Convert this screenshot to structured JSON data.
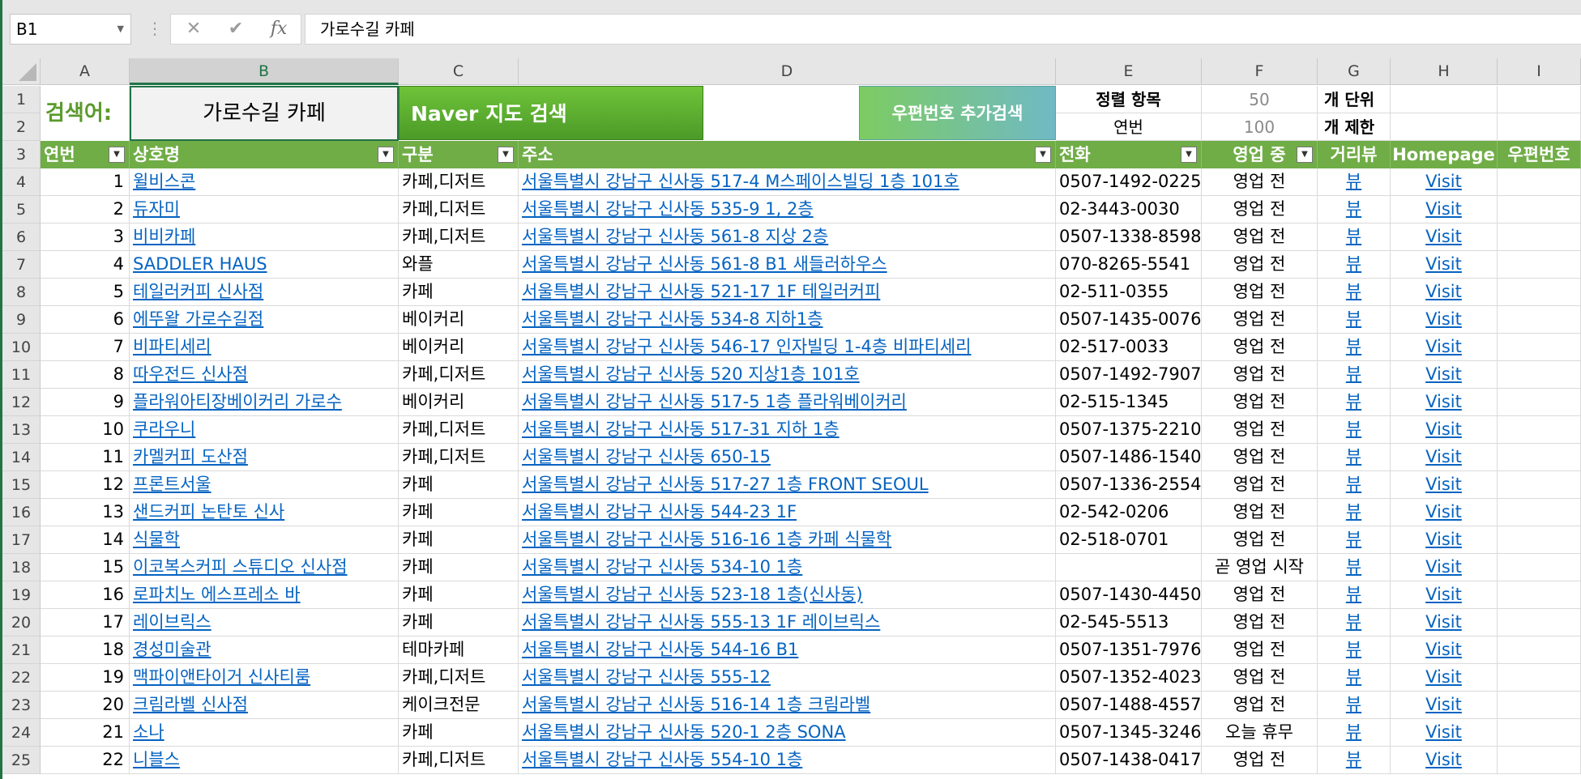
{
  "formula_bar": {
    "name_box": "B1",
    "dots": "⋮",
    "cancel": "✕",
    "enter": "✔",
    "fx": "fx",
    "value": "가로수길 카페"
  },
  "columns": [
    "A",
    "B",
    "C",
    "D",
    "E",
    "F",
    "G",
    "H",
    "I"
  ],
  "rows": [
    "1",
    "2",
    "3",
    "4",
    "5",
    "6",
    "7",
    "8",
    "9",
    "10",
    "11",
    "12",
    "13",
    "14",
    "15",
    "16",
    "17",
    "18",
    "19",
    "20",
    "21",
    "22",
    "23",
    "24",
    "25"
  ],
  "search": {
    "label": "검색어:",
    "value": "가로수길 카페",
    "naver_button": "Naver 지도 검색",
    "zip_button": "우편번호 추가검색"
  },
  "options": {
    "sort_label": "정렬 항목",
    "sort_value": "50",
    "sort_unit": "개 단위",
    "limit_label": "연번",
    "limit_value": "100",
    "limit_unit": "개 제한"
  },
  "table": {
    "headers": [
      "연번",
      "상호명",
      "구분",
      "주소",
      "전화",
      "영업 중",
      "거리뷰",
      "Homepage",
      "우편번호"
    ],
    "rows": [
      {
        "no": "1",
        "name": "윌비스콘",
        "type": "카페,디저트",
        "addr": "서울특별시 강남구 신사동 517-4 M스페이스빌딩 1층 101호",
        "phone": "0507-1492-0225",
        "status": "영업 전",
        "view": "뷰",
        "home": "Visit"
      },
      {
        "no": "2",
        "name": "듀자미",
        "type": "카페,디저트",
        "addr": "서울특별시 강남구 신사동 535-9 1, 2층",
        "phone": "02-3443-0030",
        "status": "영업 전",
        "view": "뷰",
        "home": "Visit"
      },
      {
        "no": "3",
        "name": "비비카페",
        "type": "카페,디저트",
        "addr": "서울특별시 강남구 신사동 561-8 지상 2층",
        "phone": "0507-1338-8598",
        "status": "영업 전",
        "view": "뷰",
        "home": "Visit"
      },
      {
        "no": "4",
        "name": "SADDLER HAUS",
        "type": "와플",
        "addr": "서울특별시 강남구 신사동 561-8 B1 새들러하우스",
        "phone": "070-8265-5541",
        "status": "영업 전",
        "view": "뷰",
        "home": "Visit"
      },
      {
        "no": "5",
        "name": "테일러커피 신사점",
        "type": "카페",
        "addr": "서울특별시 강남구 신사동 521-17 1F 테일러커피",
        "phone": "02-511-0355",
        "status": "영업 전",
        "view": "뷰",
        "home": "Visit"
      },
      {
        "no": "6",
        "name": "에뚜왈 가로수길점",
        "type": "베이커리",
        "addr": "서울특별시 강남구 신사동 534-8 지하1층",
        "phone": "0507-1435-0076",
        "status": "영업 전",
        "view": "뷰",
        "home": "Visit"
      },
      {
        "no": "7",
        "name": "비파티세리",
        "type": "베이커리",
        "addr": "서울특별시 강남구 신사동 546-17 인자빌딩 1-4층 비파티세리",
        "phone": "02-517-0033",
        "status": "영업 전",
        "view": "뷰",
        "home": "Visit"
      },
      {
        "no": "8",
        "name": "따우전드 신사점",
        "type": "카페,디저트",
        "addr": "서울특별시 강남구 신사동 520 지상1층 101호",
        "phone": "0507-1492-7907",
        "status": "영업 전",
        "view": "뷰",
        "home": "Visit"
      },
      {
        "no": "9",
        "name": "플라워아티장베이커리 가로수",
        "type": "베이커리",
        "addr": "서울특별시 강남구 신사동 517-5 1층 플라워베이커리",
        "phone": "02-515-1345",
        "status": "영업 전",
        "view": "뷰",
        "home": "Visit"
      },
      {
        "no": "10",
        "name": "쿠라우니",
        "type": "카페,디저트",
        "addr": "서울특별시 강남구 신사동 517-31 지하 1층",
        "phone": "0507-1375-2210",
        "status": "영업 전",
        "view": "뷰",
        "home": "Visit"
      },
      {
        "no": "11",
        "name": "카멜커피 도산점",
        "type": "카페,디저트",
        "addr": "서울특별시 강남구 신사동 650-15",
        "phone": "0507-1486-1540",
        "status": "영업 전",
        "view": "뷰",
        "home": "Visit"
      },
      {
        "no": "12",
        "name": "프론트서울",
        "type": "카페",
        "addr": "서울특별시 강남구 신사동 517-27 1층 FRONT SEOUL",
        "phone": "0507-1336-2554",
        "status": "영업 전",
        "view": "뷰",
        "home": "Visit"
      },
      {
        "no": "13",
        "name": "샌드커피 논탄토 신사",
        "type": "카페",
        "addr": "서울특별시 강남구 신사동 544-23 1F",
        "phone": "02-542-0206",
        "status": "영업 전",
        "view": "뷰",
        "home": "Visit"
      },
      {
        "no": "14",
        "name": "식물학",
        "type": "카페",
        "addr": "서울특별시 강남구 신사동 516-16 1층 카페 식물학",
        "phone": "02-518-0701",
        "status": "영업 전",
        "view": "뷰",
        "home": "Visit"
      },
      {
        "no": "15",
        "name": "이코복스커피 스튜디오 신사점",
        "type": "카페",
        "addr": "서울특별시 강남구 신사동 534-10 1층",
        "phone": "",
        "status": "곧 영업 시작",
        "view": "뷰",
        "home": "Visit"
      },
      {
        "no": "16",
        "name": "로파치노 에스프레소 바",
        "type": "카페",
        "addr": "서울특별시 강남구 신사동 523-18 1층(신사동)",
        "phone": "0507-1430-4450",
        "status": "영업 전",
        "view": "뷰",
        "home": "Visit"
      },
      {
        "no": "17",
        "name": "레이브릭스",
        "type": "카페",
        "addr": "서울특별시 강남구 신사동 555-13 1F 레이브릭스",
        "phone": "02-545-5513",
        "status": "영업 전",
        "view": "뷰",
        "home": "Visit"
      },
      {
        "no": "18",
        "name": "경성미술관",
        "type": "테마카페",
        "addr": "서울특별시 강남구 신사동 544-16 B1",
        "phone": "0507-1351-7976",
        "status": "영업 전",
        "view": "뷰",
        "home": "Visit"
      },
      {
        "no": "19",
        "name": "맥파이앤타이거 신사티룸",
        "type": "카페,디저트",
        "addr": "서울특별시 강남구 신사동 555-12",
        "phone": "0507-1352-4023",
        "status": "영업 전",
        "view": "뷰",
        "home": "Visit"
      },
      {
        "no": "20",
        "name": "크림라벨 신사점",
        "type": "케이크전문",
        "addr": "서울특별시 강남구 신사동 516-14 1층 크림라벨",
        "phone": "0507-1488-4557",
        "status": "영업 전",
        "view": "뷰",
        "home": "Visit"
      },
      {
        "no": "21",
        "name": "소나",
        "type": "카페",
        "addr": "서울특별시 강남구 신사동 520-1 2층 SONA",
        "phone": "0507-1345-3246",
        "status": "오늘 휴무",
        "view": "뷰",
        "home": "Visit"
      },
      {
        "no": "22",
        "name": "니블스",
        "type": "카페,디저트",
        "addr": "서울특별시 강남구 신사동 554-10 1층",
        "phone": "0507-1438-0417",
        "status": "영업 전",
        "view": "뷰",
        "home": "Visit"
      }
    ]
  },
  "colors": {
    "excel_green": "#217346",
    "table_header": "#70ad47",
    "link": "#0563c1"
  }
}
